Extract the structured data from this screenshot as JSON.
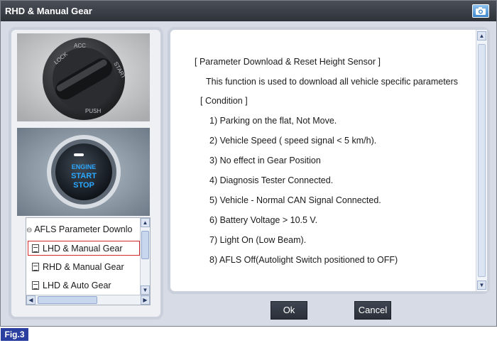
{
  "window": {
    "title": "RHD & Manual Gear",
    "camera_icon": "camera-icon"
  },
  "images": [
    {
      "name": "ignition-key-cylinder",
      "labels": [
        "LOCK",
        "ACC",
        "START",
        "PUSH"
      ]
    },
    {
      "name": "engine-start-stop-button",
      "labels": [
        "ENGINE",
        "START",
        "STOP"
      ]
    }
  ],
  "tree": {
    "parent": "AFLS Parameter Downlo",
    "items": [
      {
        "label": "LHD & Manual Gear",
        "selected": true
      },
      {
        "label": "RHD & Manual Gear",
        "selected": false
      },
      {
        "label": "LHD & Auto Gear",
        "selected": false
      }
    ],
    "selection_color": "#d22a2a"
  },
  "content": {
    "header": "[ Parameter Download & Reset Height Sensor ]",
    "description": "This function is used to download all vehicle specific parameters",
    "condition_header": "[ Condition ]",
    "conditions": [
      "1) Parking on the flat, Not Move.",
      "2) Vehicle Speed ( speed signal < 5 km/h).",
      "3) No effect in Gear Position",
      "4) Diagnosis Tester Connected.",
      "5) Vehicle - Normal CAN Signal Connected.",
      "6) Battery Voltage > 10.5 V.",
      "7) Light On (Low Beam).",
      "8) AFLS Off(Autolight Switch positioned to OFF)"
    ]
  },
  "buttons": {
    "ok": "Ok",
    "cancel": "Cancel"
  },
  "figure_label": "Fig.3",
  "colors": {
    "title_bar": "#2e3238",
    "button": "#2a2f38",
    "fig_label": "#2a3fa0"
  }
}
